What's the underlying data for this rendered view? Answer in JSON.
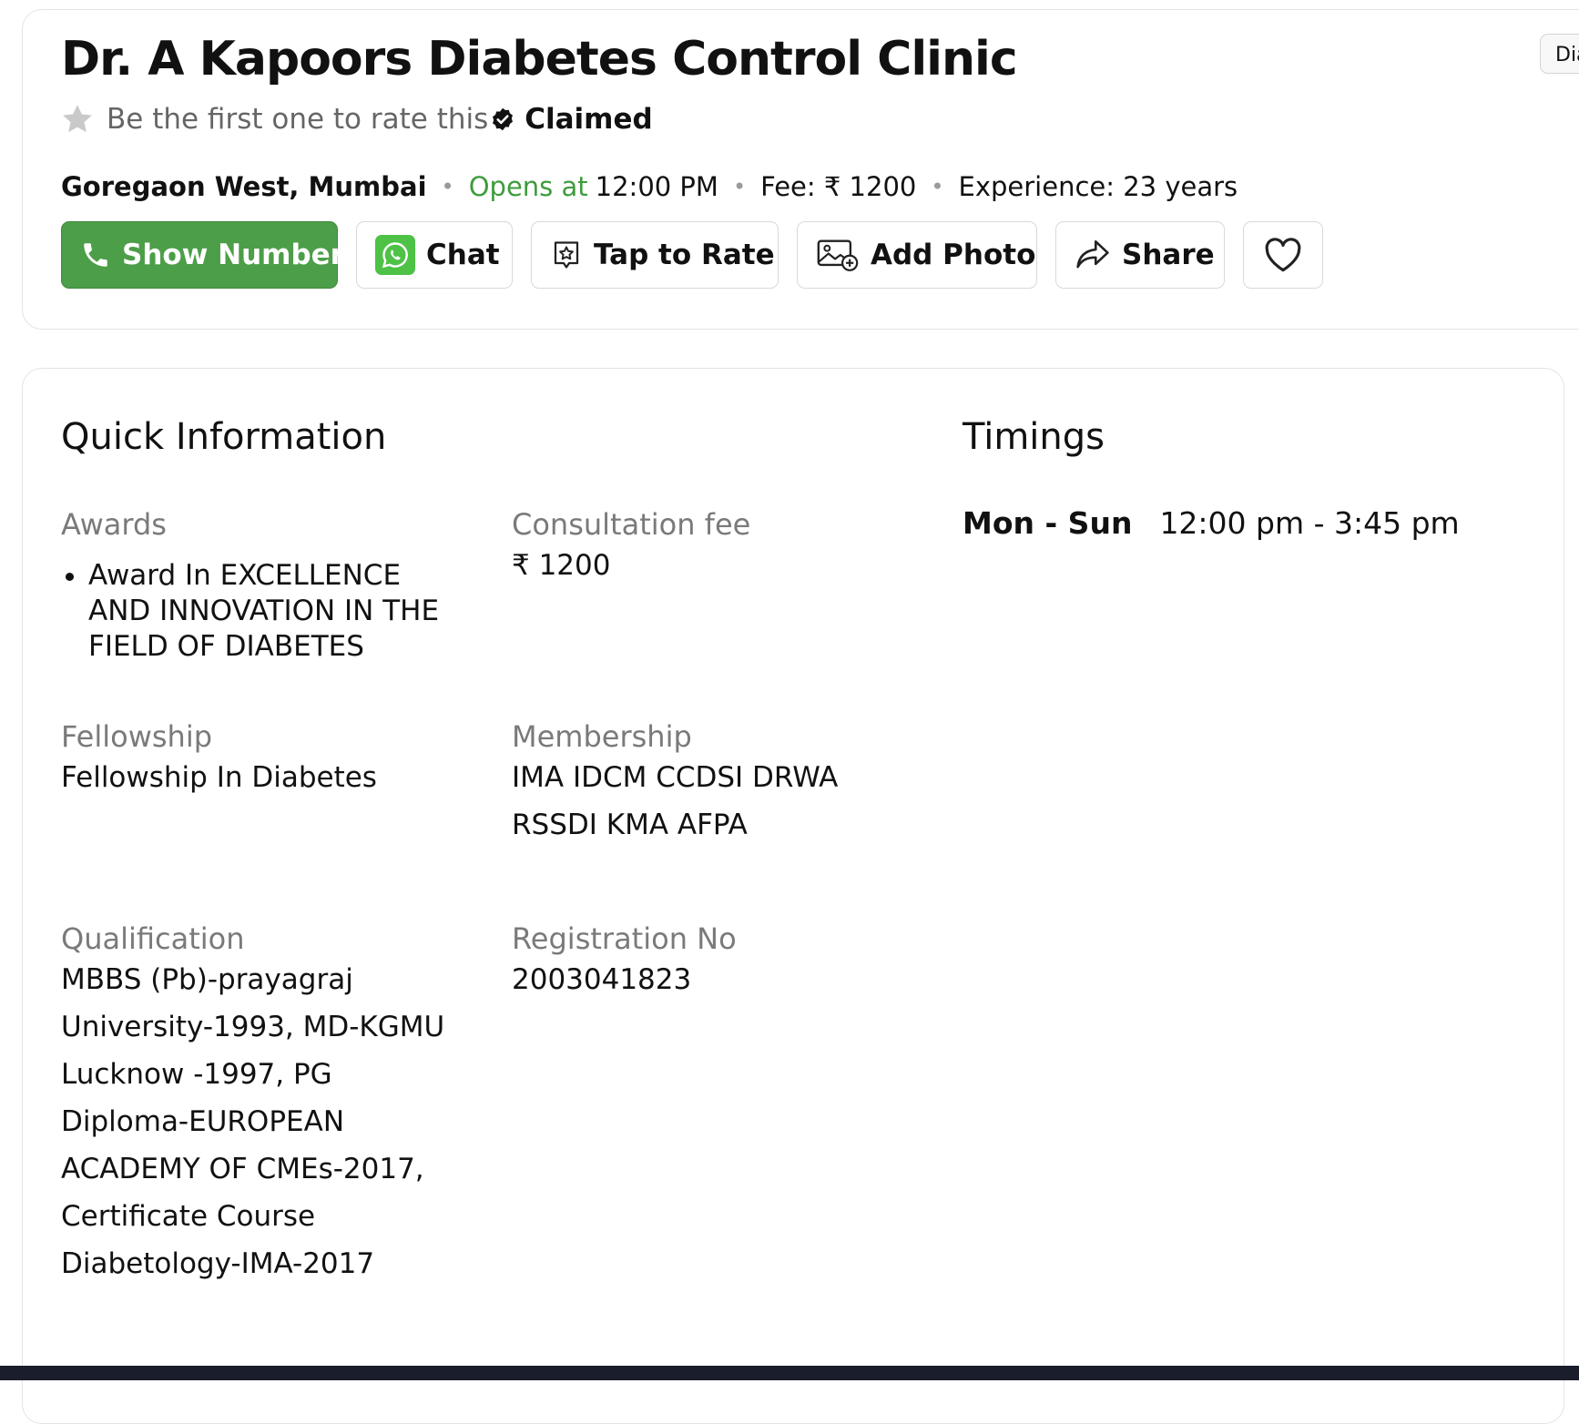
{
  "header": {
    "title": "Dr. A Kapoors Diabetes Control Clinic",
    "tag_chip": "Dia",
    "rating_prompt": "Be the first one to rate this",
    "claimed_label": "Claimed",
    "location": "Goregaon West, Mumbai",
    "opens_label": "Opens at",
    "opens_time": "12:00 PM",
    "fee": "Fee: ₹ 1200",
    "experience": "Experience: 23 years",
    "colors": {
      "primary_green": "#4c9e48",
      "opens_green": "#3e9c3e",
      "whatsapp_green": "#4dc247"
    }
  },
  "actions": {
    "show_number": "Show Number",
    "chat": "Chat",
    "tap_to_rate": "Tap to Rate",
    "add_photo": "Add Photo",
    "share": "Share"
  },
  "icons": [
    "star-icon",
    "verified-check-icon",
    "phone-icon",
    "whatsapp-icon",
    "rate-star-icon",
    "add-photo-icon",
    "share-arrow-icon",
    "heart-icon"
  ],
  "quick_info": {
    "title": "Quick Information",
    "awards_label": "Awards",
    "awards": [
      "Award In EXCELLENCE AND INNOVATION IN THE FIELD OF DIABETES"
    ],
    "consultation_fee_label": "Consultation fee",
    "consultation_fee": "₹ 1200",
    "fellowship_label": "Fellowship",
    "fellowship": "Fellowship In Diabetes",
    "membership_label": "Membership",
    "membership_line1": "IMA IDCM CCDSI DRWA",
    "membership_line2": "RSSDI KMA AFPA",
    "qualification_label": "Qualification",
    "qualification": "MBBS (Pb)-prayagraj University-1993, MD-KGMU Lucknow -1997, PG Diploma-EUROPEAN ACADEMY OF CMEs-2017, Certificate Course Diabetology-IMA-2017",
    "registration_label": "Registration No",
    "registration": "2003041823"
  },
  "timings": {
    "title": "Timings",
    "days": "Mon - Sun",
    "hours": "12:00 pm - 3:45 pm"
  }
}
